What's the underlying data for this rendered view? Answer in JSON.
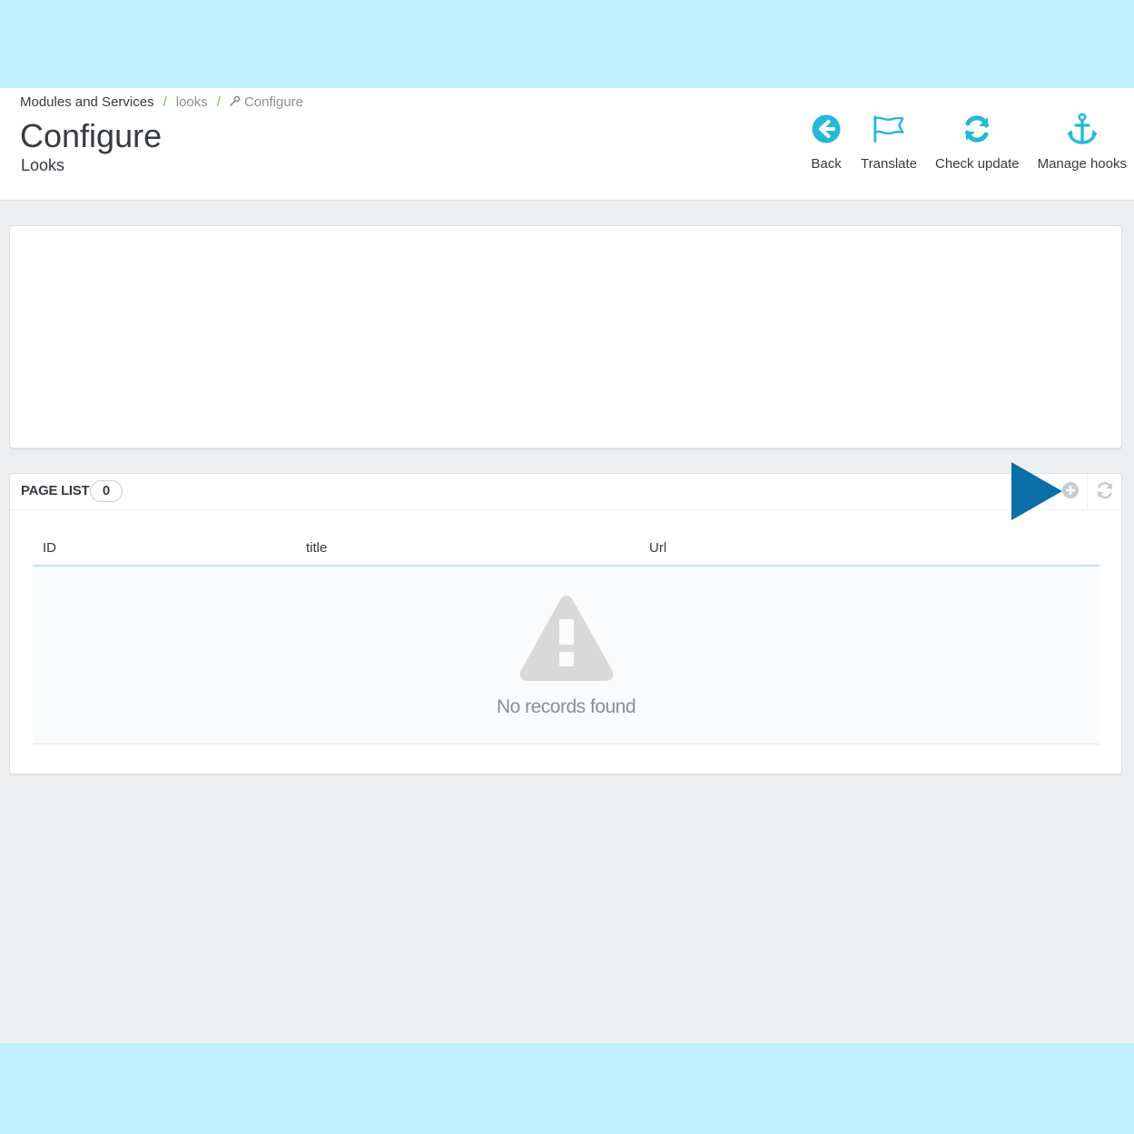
{
  "breadcrumb": {
    "item1": "Modules and Services",
    "separator": "/",
    "item2": "looks",
    "item3": "Configure"
  },
  "header": {
    "title": "Configure",
    "subtitle": "Looks"
  },
  "toolbar": {
    "back_label": "Back",
    "translate_label": "Translate",
    "check_update_label": "Check update",
    "manage_hooks_label": "Manage hooks"
  },
  "page_list": {
    "title": "PAGE LIST",
    "count": "0",
    "columns": [
      "ID",
      "title",
      "Url"
    ],
    "empty_message": "No records found"
  },
  "colors": {
    "accent": "#25b9d7",
    "frame_background": "#c1f0fd",
    "pointer_arrow": "#0b6ea9"
  }
}
